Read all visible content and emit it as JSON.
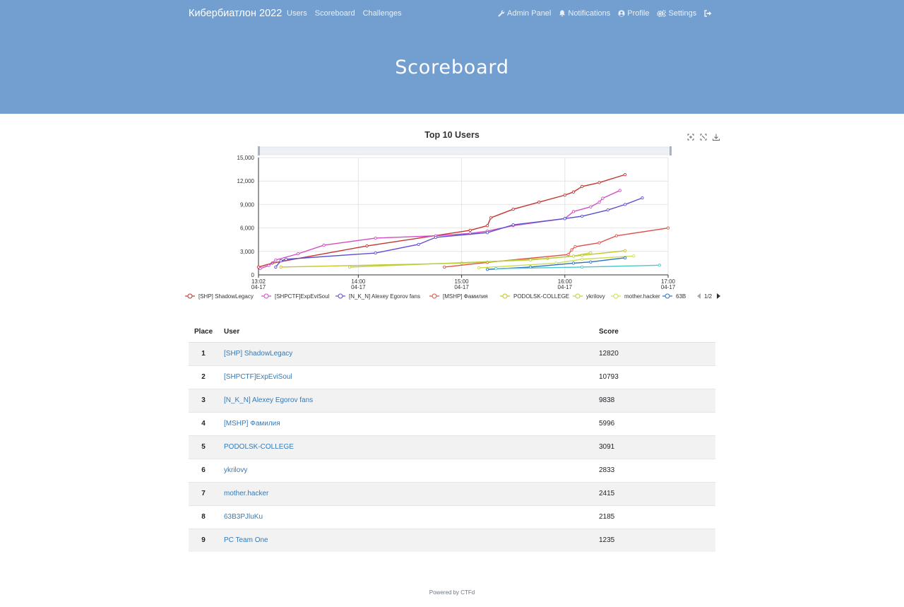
{
  "nav": {
    "brand": "Кибербиатлон 2022",
    "left": [
      {
        "label": "Users",
        "name": "nav-users"
      },
      {
        "label": "Scoreboard",
        "name": "nav-scoreboard"
      },
      {
        "label": "Challenges",
        "name": "nav-challenges"
      }
    ],
    "right": [
      {
        "label": "Admin Panel",
        "name": "nav-admin-panel",
        "icon": "wrench-icon"
      },
      {
        "label": "Notifications",
        "name": "nav-notifications",
        "icon": "bell-icon"
      },
      {
        "label": "Profile",
        "name": "nav-profile",
        "icon": "user-circle-icon"
      },
      {
        "label": "Settings",
        "name": "nav-settings",
        "icon": "cogs-icon"
      },
      {
        "label": "",
        "name": "nav-logout",
        "icon": "sign-out-icon"
      }
    ]
  },
  "header": {
    "title": "Scoreboard"
  },
  "chart_data": {
    "type": "line",
    "title": "Top 10 Users",
    "x_axis": {
      "type": "time",
      "ticks": [
        "13:02\n04-17",
        "14:00\n04-17",
        "15:00\n04-17",
        "16:00\n04-17",
        "17:00\n04-17"
      ],
      "range": [
        "13:02",
        "17:00"
      ]
    },
    "y_axis": {
      "ticks": [
        "0",
        "3,000",
        "6,000",
        "9,000",
        "12,000",
        "15,000"
      ],
      "range": [
        0,
        15000
      ]
    },
    "grid": true,
    "legend": {
      "position": "bottom",
      "page": "1/2"
    },
    "toolbox": [
      "zoom-icon",
      "zoom-reset-icon",
      "download-icon"
    ],
    "series": [
      {
        "name": "[SHP] ShadowLegacy",
        "color": "#c23531",
        "points": [
          [
            "13:02",
            1000
          ],
          [
            "13:10",
            1500
          ],
          [
            "14:05",
            3700
          ],
          [
            "15:05",
            5700
          ],
          [
            "15:15",
            6300
          ],
          [
            "15:17",
            7300
          ],
          [
            "15:30",
            8400
          ],
          [
            "15:45",
            9300
          ],
          [
            "16:00",
            10200
          ],
          [
            "16:05",
            10600
          ],
          [
            "16:10",
            11300
          ],
          [
            "16:20",
            11800
          ],
          [
            "16:35",
            12820
          ]
        ]
      },
      {
        "name": "[SHPCTF]ExpEviSoul",
        "color": "#d24dc4",
        "points": [
          [
            "13:03",
            800
          ],
          [
            "13:08",
            1200
          ],
          [
            "13:12",
            1900
          ],
          [
            "13:25",
            2700
          ],
          [
            "13:40",
            3800
          ],
          [
            "14:10",
            4700
          ],
          [
            "14:45",
            5000
          ],
          [
            "15:05",
            5300
          ],
          [
            "15:15",
            5600
          ],
          [
            "15:30",
            6300
          ],
          [
            "16:00",
            7200
          ],
          [
            "16:05",
            8100
          ],
          [
            "16:15",
            8700
          ],
          [
            "16:20",
            9300
          ],
          [
            "16:22",
            9800
          ],
          [
            "16:32",
            10793
          ]
        ]
      },
      {
        "name": "[N_K_N] Alexey Egorov fans",
        "color": "#5a4fd1",
        "points": [
          [
            "13:12",
            1000
          ],
          [
            "13:15",
            1800
          ],
          [
            "13:18",
            2000
          ],
          [
            "14:10",
            2800
          ],
          [
            "14:35",
            3900
          ],
          [
            "14:45",
            4800
          ],
          [
            "15:15",
            5400
          ],
          [
            "15:30",
            6400
          ],
          [
            "16:00",
            7200
          ],
          [
            "16:10",
            7500
          ],
          [
            "16:25",
            8300
          ],
          [
            "16:35",
            9000
          ],
          [
            "16:45",
            9838
          ]
        ]
      },
      {
        "name": "[MSHP] Фамилия",
        "color": "#e0504a",
        "points": [
          [
            "14:50",
            1000
          ],
          [
            "15:15",
            1600
          ],
          [
            "16:02",
            2600
          ],
          [
            "16:04",
            3200
          ],
          [
            "16:06",
            3600
          ],
          [
            "16:20",
            4100
          ],
          [
            "16:30",
            5000
          ],
          [
            "17:00",
            5996
          ]
        ]
      },
      {
        "name": "PODOLSK-COLLEGE",
        "color": "#c9c22a",
        "points": [
          [
            "13:15",
            1000
          ],
          [
            "15:00",
            1500
          ],
          [
            "15:50",
            2100
          ],
          [
            "16:10",
            2500
          ],
          [
            "16:35",
            3091
          ]
        ]
      },
      {
        "name": "ykrilovy",
        "color": "#b5d43a",
        "points": [
          [
            "13:55",
            1000
          ],
          [
            "15:40",
            1900
          ],
          [
            "16:05",
            2400
          ],
          [
            "16:15",
            2833
          ]
        ]
      },
      {
        "name": "mother.hacker",
        "color": "#c9e04a",
        "points": [
          [
            "15:10",
            900
          ],
          [
            "15:55",
            1500
          ],
          [
            "16:10",
            2000
          ],
          [
            "16:40",
            2415
          ]
        ]
      },
      {
        "name": "63B3PJluKu",
        "color": "#2a6fc9",
        "points": [
          [
            "15:15",
            700
          ],
          [
            "15:40",
            1000
          ],
          [
            "16:05",
            1500
          ],
          [
            "16:15",
            1650
          ],
          [
            "16:35",
            2185
          ]
        ]
      },
      {
        "name": "PC Team One",
        "color": "#4cc7c9",
        "points": [
          [
            "15:20",
            800
          ],
          [
            "16:10",
            1000
          ],
          [
            "16:55",
            1235
          ]
        ]
      }
    ]
  },
  "legend_visible": [
    "[SHP] ShadowLegacy",
    "[SHPCTF]ExpEviSoul",
    "[N_K_N] Alexey Egorov fans",
    "[MSHP] Фамилия",
    "PODOLSK-COLLEGE",
    "ykrilovy",
    "mother.hacker",
    "63B"
  ],
  "table": {
    "headers": {
      "place": "Place",
      "user": "User",
      "score": "Score"
    },
    "rows": [
      {
        "place": "1",
        "user": "[SHP] ShadowLegacy",
        "score": "12820"
      },
      {
        "place": "2",
        "user": "[SHPCTF]ExpEviSoul",
        "score": "10793"
      },
      {
        "place": "3",
        "user": "[N_K_N] Alexey Egorov fans",
        "score": "9838"
      },
      {
        "place": "4",
        "user": "[MSHP] Фамилия",
        "score": "5996"
      },
      {
        "place": "5",
        "user": "PODOLSK-COLLEGE",
        "score": "3091"
      },
      {
        "place": "6",
        "user": "ykrilovy",
        "score": "2833"
      },
      {
        "place": "7",
        "user": "mother.hacker",
        "score": "2415"
      },
      {
        "place": "8",
        "user": "63B3PJluKu",
        "score": "2185"
      },
      {
        "place": "9",
        "user": "PC Team One",
        "score": "1235"
      }
    ]
  },
  "footer": {
    "text": "Powered by CTFd"
  },
  "colors": {
    "header_bg": "#729fcf",
    "link": "#337ab7",
    "stripe": "#f2f2f2"
  }
}
